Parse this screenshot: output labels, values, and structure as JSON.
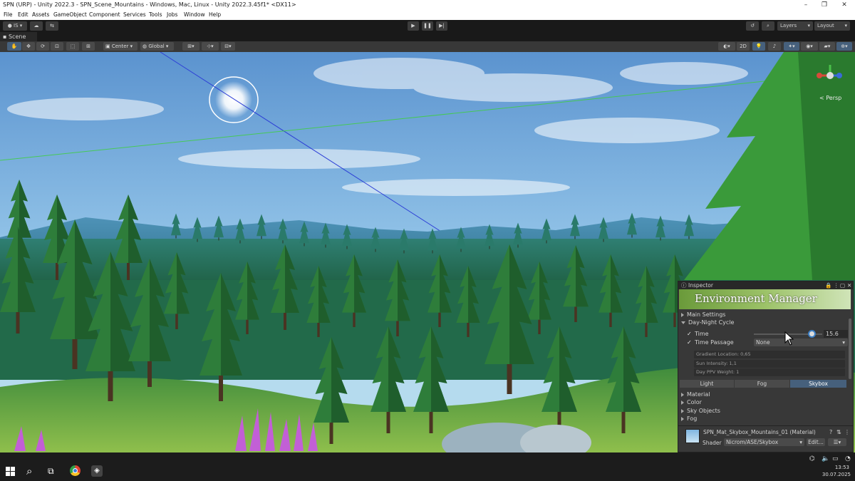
{
  "window": {
    "title": "SPN (URP) - Unity 2022.3 - SPN_Scene_Mountains - Windows, Mac, Linux - Unity 2022.3.45f1* <DX11>",
    "minimize": "–",
    "maximize": "❐",
    "close": "✕"
  },
  "menu": [
    "File",
    "Edit",
    "Assets",
    "GameObject",
    "Component",
    "Services",
    "Tools",
    "Jobs",
    "Window",
    "Help"
  ],
  "toolbar": {
    "account_label": "IS",
    "layers_label": "Layers",
    "layout_label": "Layout"
  },
  "scene_tab": {
    "label": "Scene"
  },
  "scene_toolbar": {
    "pivot_label": "Center",
    "space_label": "Global",
    "mode_2d_label": "2D"
  },
  "gizmo": {
    "persp_label": "< Persp"
  },
  "inspector": {
    "tab_label": "Inspector",
    "banner_title": "Environment Manager",
    "sections": {
      "main_settings": "Main Settings",
      "day_night": "Day-Night Cycle"
    },
    "time": {
      "label": "Time",
      "value": "15.6",
      "slider_fraction": 0.85
    },
    "time_passage": {
      "label": "Time Passage",
      "value": "None"
    },
    "readonly_fields": [
      "Gradient Location: 0,65",
      "Sun Intensity: 1,1",
      "Day PPV Weight: 1"
    ],
    "tabs": [
      {
        "label": "Light",
        "active": false
      },
      {
        "label": "Fog",
        "active": false
      },
      {
        "label": "Skybox",
        "active": true
      }
    ],
    "subsections": [
      "Material",
      "Color",
      "Sky Objects",
      "Fog"
    ],
    "material": {
      "name": "SPN_Mat_Skybox_Mountains_01 (Material)",
      "shader_label": "Shader",
      "shader_value": "Nicrom/ASE/Skybox",
      "edit_label": "Edit..."
    }
  },
  "taskbar": {
    "time": "13:53",
    "date": "30.07.2025"
  },
  "colors": {
    "unity_dark": "#383838",
    "selection_blue": "#46607c",
    "sky_top": "#6ea4d6",
    "foliage": "#2f8a3c"
  }
}
